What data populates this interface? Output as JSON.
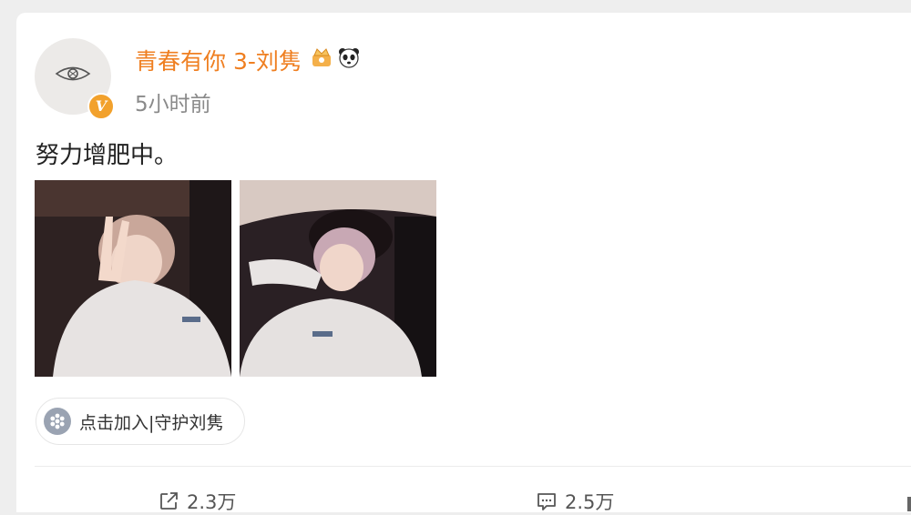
{
  "post": {
    "username": "青春有你 3-刘隽",
    "time": "5小时前",
    "text": "努力增肥中。",
    "verified_badge": "V",
    "user_icons": [
      "crown-badge-icon",
      "panda-icon"
    ],
    "images": [
      "photo-peace-sign",
      "photo-car-seat"
    ],
    "group": {
      "label": "点击加入|守护刘隽",
      "icon": "flower-icon"
    }
  },
  "actions": {
    "repost_count": "2.3万",
    "comment_count": "2.5万"
  },
  "colors": {
    "username": "#ef7f21",
    "time": "#8a8a8a",
    "badge": "#f2a12c"
  }
}
